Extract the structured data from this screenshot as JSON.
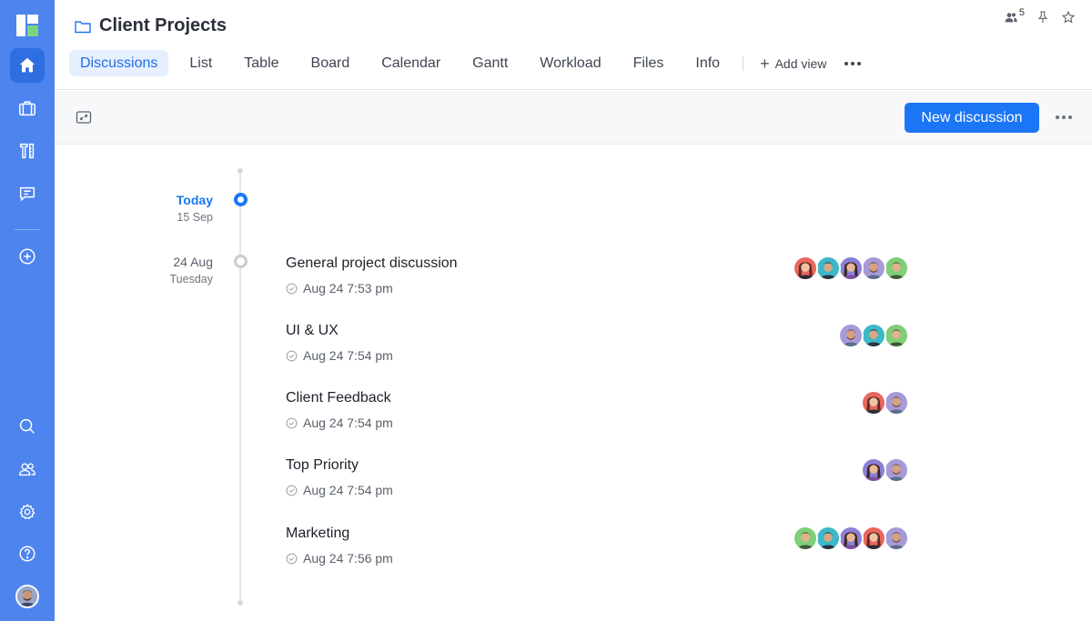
{
  "header": {
    "title": "Client Projects",
    "member_count": "5",
    "tabs": [
      {
        "label": "Discussions",
        "active": true
      },
      {
        "label": "List"
      },
      {
        "label": "Table"
      },
      {
        "label": "Board"
      },
      {
        "label": "Calendar"
      },
      {
        "label": "Gantt"
      },
      {
        "label": "Workload"
      },
      {
        "label": "Files"
      },
      {
        "label": "Info"
      }
    ],
    "add_view_label": "Add view"
  },
  "toolbar": {
    "new_discussion_label": "New discussion"
  },
  "sidebar": {
    "icons": [
      "home-icon",
      "briefcase-icon",
      "tools-icon",
      "chat-icon",
      "add-icon",
      "search-icon",
      "people-icon",
      "settings-icon",
      "help-icon"
    ]
  },
  "timeline": {
    "today": {
      "label": "Today",
      "date": "15 Sep"
    },
    "group": {
      "label": "24 Aug",
      "weekday": "Tuesday"
    },
    "discussions": [
      {
        "title": "General project discussion",
        "time": "Aug 24 7:53 pm",
        "avatars": [
          "woman-red",
          "man-teal",
          "woman-purple",
          "man-purple",
          "man-green"
        ]
      },
      {
        "title": "UI & UX",
        "time": "Aug 24 7:54 pm",
        "avatars": [
          "man-purple",
          "man-teal",
          "man-green"
        ]
      },
      {
        "title": "Client Feedback",
        "time": "Aug 24 7:54 pm",
        "avatars": [
          "woman-red",
          "man-purple"
        ]
      },
      {
        "title": "Top Priority",
        "time": "Aug 24 7:54 pm",
        "avatars": [
          "woman-purple",
          "man-purple"
        ]
      },
      {
        "title": "Marketing",
        "time": "Aug 24 7:56 pm",
        "avatars": [
          "man-green",
          "man-teal",
          "woman-purple",
          "woman-red",
          "man-purple"
        ]
      }
    ]
  },
  "colors": {
    "sidebar": "#4d84ee",
    "accent": "#1b76f5",
    "active_tab_bg": "#e6effd"
  }
}
